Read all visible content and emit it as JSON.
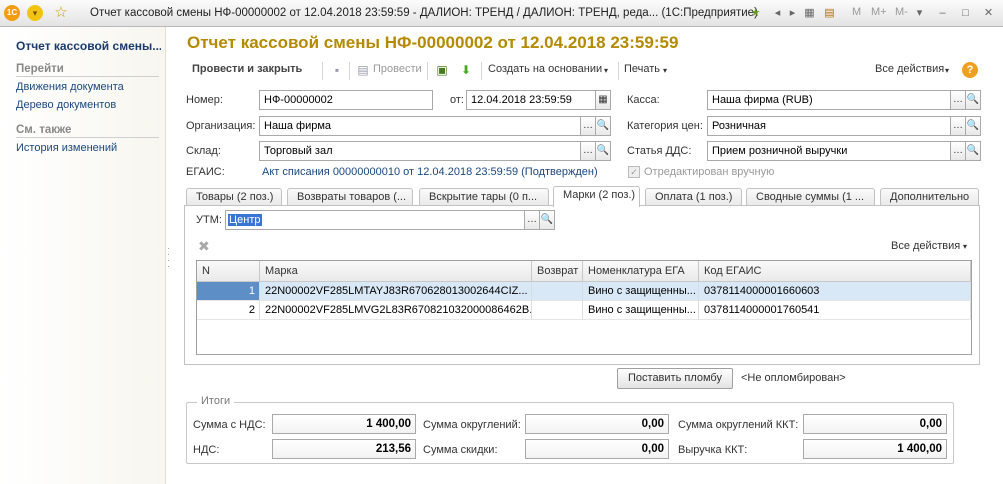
{
  "window": {
    "title": "Отчет кассовой смены НФ-00000002 от 12.04.2018 23:59:59 - ДАЛИОН: ТРЕНД / ДАЛИОН: ТРЕНД, реда... (1С:Предприятие)",
    "logo_text": "1С",
    "m_label": "M",
    "m_plus_label": "M+",
    "m_minus_label": "M-"
  },
  "sidebar": {
    "title": "Отчет кассовой смены...",
    "goto_heading": "Перейти",
    "goto_items": [
      "Движения документа",
      "Дерево документов"
    ],
    "see_also_heading": "См. также",
    "see_also_items": [
      "История изменений"
    ]
  },
  "document": {
    "title": "Отчет кассовой смены НФ-00000002 от 12.04.2018 23:59:59"
  },
  "toolbar": {
    "post_close": "Провести и закрыть",
    "post": "Провести",
    "create_based": "Создать на основании",
    "print": "Печать",
    "all_actions": "Все действия",
    "help": "?"
  },
  "form": {
    "number_label": "Номер:",
    "number_value": "НФ-00000002",
    "date_label": "от:",
    "date_value": "12.04.2018 23:59:59",
    "org_label": "Организация:",
    "org_value": "Наша фирма",
    "warehouse_label": "Склад:",
    "warehouse_value": "Торговый зал",
    "egais_label": "ЕГАИС:",
    "egais_link": "Акт списания 00000000010 от 12.04.2018 23:59:59 (Подтвержден)",
    "cash_label": "Касса:",
    "cash_value": "Наша фирма (RUB)",
    "price_cat_label": "Категория цен:",
    "price_cat_value": "Розничная",
    "dds_label": "Статья ДДС:",
    "dds_value": "Прием розничной выручки",
    "edited_label": "Отредактирован вручную",
    "edited_checked": true
  },
  "tabs": [
    "Товары (2 поз.)",
    "Возвраты товаров (...",
    "Вскрытие тары (0 п...",
    "Марки (2 поз.)",
    "Оплата (1 поз.)",
    "Сводные суммы (1 ...",
    "Дополнительно"
  ],
  "active_tab": 3,
  "marks": {
    "utm_label": "УТМ:",
    "utm_value": "Центр",
    "all_actions": "Все действия",
    "columns": [
      "N",
      "Марка",
      "Возврат",
      "Номенклатура ЕГА",
      "Код ЕГАИС"
    ],
    "rows": [
      {
        "n": "1",
        "mark": "22N00002VF285LMTAYJ83R670628013002644CIZ...",
        "return": "",
        "nomenclature": "Вино с защищенны...",
        "code": "0378114000001660603"
      },
      {
        "n": "2",
        "mark": "22N00002VF285LMVG2L83R670821032000086462B...",
        "return": "",
        "nomenclature": "Вино с защищенны...",
        "code": "0378114000001760541"
      }
    ],
    "seal_button": "Поставить пломбу",
    "seal_status": "<Не опломбирован>"
  },
  "totals": {
    "legend": "Итоги",
    "sum_vat_label": "Сумма с НДС:",
    "sum_vat": "1 400,00",
    "vat_label": "НДС:",
    "vat": "213,56",
    "rounding_label": "Сумма округлений:",
    "rounding": "0,00",
    "discount_label": "Сумма скидки:",
    "discount": "0,00",
    "kkt_rounding_label": "Сумма округлений ККТ:",
    "kkt_rounding": "0,00",
    "kkt_revenue_label": "Выручка ККТ:",
    "kkt_revenue": "1 400,00"
  }
}
